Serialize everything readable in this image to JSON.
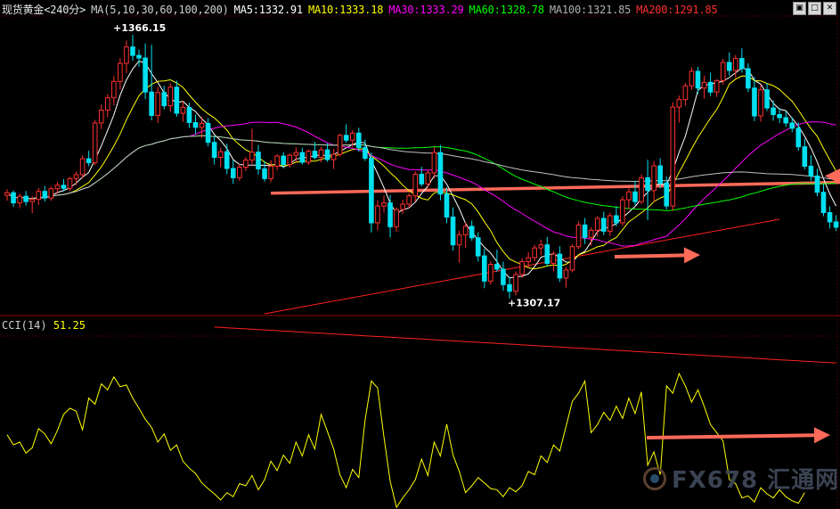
{
  "header": {
    "symbol": "现货黄金<240分>",
    "ma_params": "MA(5,10,30,60,100,200)",
    "ma5": "MA5:1332.91",
    "ma10": "MA10:1333.18",
    "ma30": "MA30:1333.29",
    "ma60": "MA60:1328.78",
    "ma100": "MA100:1321.85",
    "ma200": "MA200:1291.85"
  },
  "indicator": {
    "name": "CCI(14)",
    "value": "51.25"
  },
  "annotations": {
    "high": "1366.15",
    "low": "1307.17"
  },
  "watermark": {
    "text": "FX678 汇通网"
  },
  "window_buttons": [
    "restore-icon",
    "maximize-icon",
    "close-icon"
  ],
  "colors": {
    "background": "#000000",
    "up_candle": "#ff3030",
    "down_candle": "#00e0f0",
    "ma5": "#ffffff",
    "ma10": "#ffff00",
    "ma30": "#ff00ff",
    "ma60": "#00ff00",
    "ma100": "#c0c0c0",
    "ma200": "#ff2020",
    "cci": "#ffff00",
    "arrow": "#ff6a5a",
    "grid": "#7a0000"
  },
  "chart_data": [
    {
      "type": "candlestick",
      "title": "现货黄金<240分>",
      "ylim": [
        1303,
        1370
      ],
      "high_label": 1366.15,
      "low_label": 1307.17,
      "ohlc": [
        [
          1329.8,
          1331.2,
          1328.6,
          1330.4
        ],
        [
          1330.4,
          1330.9,
          1327.2,
          1328.1
        ],
        [
          1328.1,
          1330.2,
          1326.9,
          1329.6
        ],
        [
          1329.6,
          1330.8,
          1327.5,
          1328.4
        ],
        [
          1328.4,
          1329.7,
          1325.8,
          1328.9
        ],
        [
          1328.9,
          1331.5,
          1327.6,
          1330.7
        ],
        [
          1330.7,
          1331.9,
          1328.4,
          1329.2
        ],
        [
          1329.2,
          1331.8,
          1328.6,
          1331.3
        ],
        [
          1331.3,
          1332.8,
          1330.2,
          1332.1
        ],
        [
          1332.1,
          1333.5,
          1330.7,
          1331.4
        ],
        [
          1331.4,
          1334.0,
          1330.8,
          1333.6
        ],
        [
          1333.6,
          1335.2,
          1332.1,
          1334.5
        ],
        [
          1334.5,
          1338.8,
          1333.7,
          1338.1
        ],
        [
          1338.1,
          1339.9,
          1336.4,
          1337.2
        ],
        [
          1337.2,
          1346.9,
          1336.6,
          1346.2
        ],
        [
          1346.2,
          1350.4,
          1344.8,
          1349.1
        ],
        [
          1349.1,
          1352.7,
          1347.5,
          1351.9
        ],
        [
          1351.9,
          1356.8,
          1350.2,
          1355.6
        ],
        [
          1355.6,
          1360.9,
          1353.8,
          1359.7
        ],
        [
          1359.7,
          1364.9,
          1357.5,
          1363.4
        ],
        [
          1363.4,
          1366.15,
          1360.3,
          1361.5
        ],
        [
          1361.5,
          1362.8,
          1358.9,
          1360.9
        ],
        [
          1360.9,
          1364.2,
          1351.6,
          1353.2
        ],
        [
          1353.2,
          1363.9,
          1346.8,
          1347.9
        ],
        [
          1347.9,
          1354.4,
          1346.2,
          1353.1
        ],
        [
          1353.1,
          1354.6,
          1349.3,
          1350.1
        ],
        [
          1350.1,
          1355.2,
          1348.7,
          1354.3
        ],
        [
          1354.3,
          1355.8,
          1347.6,
          1348.4
        ],
        [
          1348.4,
          1351.2,
          1346.5,
          1349.7
        ],
        [
          1349.7,
          1350.8,
          1345.1,
          1346.3
        ],
        [
          1346.3,
          1348.1,
          1343.7,
          1345.2
        ],
        [
          1345.2,
          1347.6,
          1342.8,
          1346.1
        ],
        [
          1346.1,
          1347.3,
          1340.9,
          1341.8
        ],
        [
          1341.8,
          1343.2,
          1336.8,
          1338.4
        ],
        [
          1338.4,
          1340.6,
          1336.2,
          1339.7
        ],
        [
          1339.7,
          1341.5,
          1334.6,
          1335.9
        ],
        [
          1335.9,
          1337.8,
          1332.4,
          1333.8
        ],
        [
          1333.8,
          1336.9,
          1333.1,
          1336.2
        ],
        [
          1336.2,
          1338.5,
          1335.3,
          1337.8
        ],
        [
          1337.8,
          1344.9,
          1336.9,
          1339.6
        ],
        [
          1339.6,
          1341.2,
          1334.5,
          1335.8
        ],
        [
          1335.8,
          1337.6,
          1332.9,
          1333.6
        ],
        [
          1333.6,
          1337.8,
          1332.8,
          1336.4
        ],
        [
          1336.4,
          1339.1,
          1335.5,
          1338.7
        ],
        [
          1338.7,
          1339.6,
          1335.9,
          1336.8
        ],
        [
          1336.8,
          1339.3,
          1336.1,
          1338.9
        ],
        [
          1338.9,
          1340.7,
          1337.4,
          1339.5
        ],
        [
          1339.5,
          1340.6,
          1336.8,
          1337.3
        ],
        [
          1337.3,
          1340.2,
          1336.7,
          1339.8
        ],
        [
          1339.8,
          1341.9,
          1337.9,
          1338.4
        ],
        [
          1338.4,
          1340.8,
          1337.3,
          1340.1
        ],
        [
          1340.1,
          1341.6,
          1337.4,
          1337.9
        ],
        [
          1337.9,
          1340.3,
          1335.8,
          1339.1
        ],
        [
          1339.1,
          1343.8,
          1338.6,
          1343.4
        ],
        [
          1343.4,
          1345.9,
          1341.7,
          1342.3
        ],
        [
          1342.3,
          1344.6,
          1340.8,
          1343.9
        ],
        [
          1343.9,
          1345.1,
          1339.7,
          1340.6
        ],
        [
          1340.6,
          1342.4,
          1337.6,
          1338.2
        ],
        [
          1338.2,
          1339.5,
          1321.4,
          1323.6
        ],
        [
          1323.6,
          1328.7,
          1321.9,
          1327.4
        ],
        [
          1327.4,
          1329.8,
          1325.9,
          1328.1
        ],
        [
          1328.1,
          1329.9,
          1320.3,
          1322.7
        ],
        [
          1322.7,
          1327.1,
          1321.5,
          1326.6
        ],
        [
          1326.6,
          1328.8,
          1325.6,
          1327.8
        ],
        [
          1327.8,
          1330.3,
          1326.9,
          1329.7
        ],
        [
          1329.7,
          1335.2,
          1328.4,
          1334.6
        ],
        [
          1334.6,
          1336.3,
          1331.8,
          1332.4
        ],
        [
          1332.4,
          1335.6,
          1331.5,
          1334.9
        ],
        [
          1334.9,
          1340.8,
          1333.6,
          1339.5
        ],
        [
          1339.5,
          1341.2,
          1328.7,
          1330.1
        ],
        [
          1330.1,
          1331.6,
          1323.5,
          1324.9
        ],
        [
          1324.9,
          1327.1,
          1317.3,
          1318.6
        ],
        [
          1318.6,
          1321.8,
          1314.6,
          1320.9
        ],
        [
          1320.9,
          1323.7,
          1317.9,
          1322.8
        ],
        [
          1322.8,
          1324.1,
          1319.5,
          1320.2
        ],
        [
          1320.2,
          1321.4,
          1314.8,
          1316.1
        ],
        [
          1316.1,
          1317.7,
          1308.8,
          1310.4
        ],
        [
          1310.4,
          1314.9,
          1309.6,
          1314.2
        ],
        [
          1314.2,
          1317.5,
          1312.5,
          1313.1
        ],
        [
          1313.1,
          1314.8,
          1308.2,
          1309.6
        ],
        [
          1309.6,
          1311.3,
          1306.5,
          1308.1
        ],
        [
          1308.1,
          1312.6,
          1307.17,
          1311.9
        ],
        [
          1311.9,
          1315.6,
          1311.1,
          1314.8
        ],
        [
          1314.8,
          1316.9,
          1313.4,
          1315.7
        ],
        [
          1315.7,
          1318.6,
          1314.9,
          1317.9
        ],
        [
          1317.9,
          1319.8,
          1316.2,
          1318.6
        ],
        [
          1318.6,
          1320.4,
          1313.8,
          1314.4
        ],
        [
          1314.4,
          1317.2,
          1312.6,
          1316.5
        ],
        [
          1316.5,
          1318.3,
          1310.2,
          1311.1
        ],
        [
          1311.1,
          1313.6,
          1308.9,
          1312.9
        ],
        [
          1312.9,
          1318.7,
          1312.4,
          1318.2
        ],
        [
          1318.2,
          1323.9,
          1317.6,
          1323.1
        ],
        [
          1323.1,
          1324.7,
          1318.8,
          1320.3
        ],
        [
          1320.3,
          1322.6,
          1318.4,
          1321.9
        ],
        [
          1321.9,
          1325.1,
          1320.5,
          1324.6
        ],
        [
          1324.6,
          1326.1,
          1320.8,
          1321.7
        ],
        [
          1321.7,
          1325.9,
          1320.6,
          1325.2
        ],
        [
          1325.2,
          1327.4,
          1322.8,
          1323.6
        ],
        [
          1323.6,
          1329.6,
          1322.9,
          1328.8
        ],
        [
          1328.8,
          1331.4,
          1326.7,
          1330.6
        ],
        [
          1330.6,
          1333.1,
          1327.6,
          1328.4
        ],
        [
          1328.4,
          1334.6,
          1327.9,
          1333.8
        ],
        [
          1333.8,
          1337.9,
          1324.2,
          1330.9
        ],
        [
          1330.9,
          1337.6,
          1328.3,
          1336.5
        ],
        [
          1336.5,
          1338.2,
          1331.4,
          1332.6
        ],
        [
          1332.6,
          1334.1,
          1326.6,
          1327.4
        ],
        [
          1327.4,
          1350.9,
          1326.3,
          1349.8
        ],
        [
          1349.8,
          1352.4,
          1346.3,
          1351.5
        ],
        [
          1351.5,
          1355.2,
          1350.1,
          1354.6
        ],
        [
          1354.6,
          1358.8,
          1353.7,
          1357.9
        ],
        [
          1357.9,
          1358.9,
          1352.8,
          1354.1
        ],
        [
          1354.1,
          1356.9,
          1351.7,
          1355.4
        ],
        [
          1355.4,
          1357.6,
          1352.3,
          1353.2
        ],
        [
          1353.2,
          1356.1,
          1352.1,
          1355.8
        ],
        [
          1355.8,
          1360.7,
          1354.9,
          1359.9
        ],
        [
          1359.9,
          1362.2,
          1356.9,
          1358.1
        ],
        [
          1358.1,
          1361.6,
          1356.4,
          1360.8
        ],
        [
          1360.8,
          1363.1,
          1357.6,
          1358.5
        ],
        [
          1358.5,
          1359.7,
          1353.2,
          1354.1
        ],
        [
          1354.1,
          1356.6,
          1346.6,
          1347.8
        ],
        [
          1347.8,
          1354.9,
          1346.5,
          1353.7
        ],
        [
          1353.7,
          1355.2,
          1348.9,
          1349.6
        ],
        [
          1349.6,
          1351.3,
          1346.7,
          1348.1
        ],
        [
          1348.1,
          1349.6,
          1346.2,
          1347.4
        ],
        [
          1347.4,
          1348.9,
          1345.3,
          1346.2
        ],
        [
          1346.2,
          1347.5,
          1344.1,
          1345.0
        ],
        [
          1345.0,
          1346.3,
          1339.9,
          1340.8
        ],
        [
          1340.8,
          1342.6,
          1335.7,
          1336.4
        ],
        [
          1336.4,
          1338.9,
          1333.1,
          1334.2
        ],
        [
          1334.2,
          1335.8,
          1329.6,
          1330.5
        ],
        [
          1330.5,
          1332.4,
          1325.1,
          1325.9
        ],
        [
          1325.9,
          1327.3,
          1322.3,
          1323.8
        ],
        [
          1323.8,
          1325.3,
          1321.8,
          1322.6
        ]
      ],
      "moving_averages": {
        "MA5": 1332.91,
        "MA10": 1333.18,
        "MA30": 1333.29,
        "MA60": 1328.78,
        "MA100": 1321.85,
        "MA200": 1291.85
      },
      "trend_lines": [
        {
          "from": [
            42,
            1330.3
          ],
          "to": [
            165,
            1333.6
          ]
        },
        {
          "from": [
            41,
            1303.0
          ],
          "to": [
            123,
            1324.4
          ]
        }
      ]
    },
    {
      "type": "line",
      "title": "CCI(14)",
      "last_value": 51.25,
      "ylim": [
        -210,
        210
      ],
      "series": [
        {
          "name": "CCI(14)",
          "values": [
            -30,
            -55,
            -48,
            -75,
            -62,
            -15,
            -28,
            -52,
            -20,
            20,
            35,
            28,
            -18,
            60,
            45,
            95,
            80,
            112,
            88,
            92,
            60,
            35,
            8,
            -12,
            -48,
            -28,
            -68,
            -55,
            -95,
            -112,
            -125,
            -148,
            -162,
            -175,
            -190,
            -172,
            -182,
            -150,
            -155,
            -130,
            -165,
            -140,
            -95,
            -118,
            -80,
            -100,
            -48,
            -82,
            -30,
            -65,
            20,
            -22,
            -65,
            -128,
            -160,
            -115,
            -135,
            5,
            102,
            85,
            -35,
            -145,
            -208,
            -185,
            -165,
            -140,
            -90,
            -130,
            -48,
            -82,
            -4,
            -80,
            -120,
            -172,
            -155,
            -135,
            -148,
            -162,
            -165,
            -182,
            -160,
            -170,
            -155,
            -120,
            -128,
            -82,
            -98,
            -55,
            -70,
            -10,
            52,
            72,
            102,
            -25,
            -5,
            25,
            5,
            40,
            10,
            60,
            22,
            75,
            -105,
            -72,
            -128,
            90,
            72,
            120,
            90,
            50,
            80,
            40,
            -5,
            -25,
            -45,
            -140,
            -150,
            -185,
            -180,
            -195,
            -160,
            -175,
            -185,
            -165,
            -182,
            -192,
            -198,
            -172
          ]
        }
      ]
    }
  ]
}
